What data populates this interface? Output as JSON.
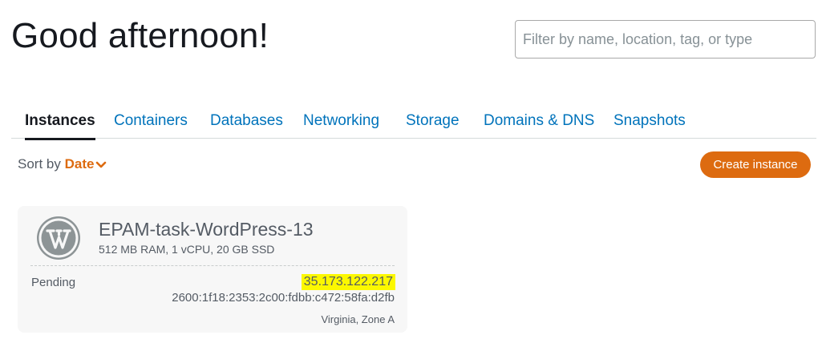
{
  "header": {
    "greeting": "Good afternoon!",
    "filter_placeholder": "Filter by name, location, tag, or type"
  },
  "tabs": [
    {
      "label": "Instances",
      "active": true
    },
    {
      "label": "Containers",
      "active": false
    },
    {
      "label": "Databases",
      "active": false
    },
    {
      "label": "Networking",
      "active": false
    },
    {
      "label": "Storage",
      "active": false
    },
    {
      "label": "Domains & DNS",
      "active": false
    },
    {
      "label": "Snapshots",
      "active": false
    }
  ],
  "toolbar": {
    "sort_label": "Sort by",
    "sort_value": "Date",
    "create_label": "Create instance"
  },
  "instances": [
    {
      "name": "EPAM-task-WordPress-13",
      "specs": "512 MB RAM, 1 vCPU, 20 GB SSD",
      "status": "Pending",
      "ipv4": "35.173.122.217",
      "ipv6": "2600:1f18:2353:2c00:fdbb:c472:58fa:d2fb",
      "region": "Virginia, Zone A",
      "icon": "wordpress-icon"
    }
  ],
  "colors": {
    "accent": "#dd6b10",
    "link": "#0073bb",
    "highlight": "#fcf800",
    "card_bg": "#f7f7f7"
  }
}
